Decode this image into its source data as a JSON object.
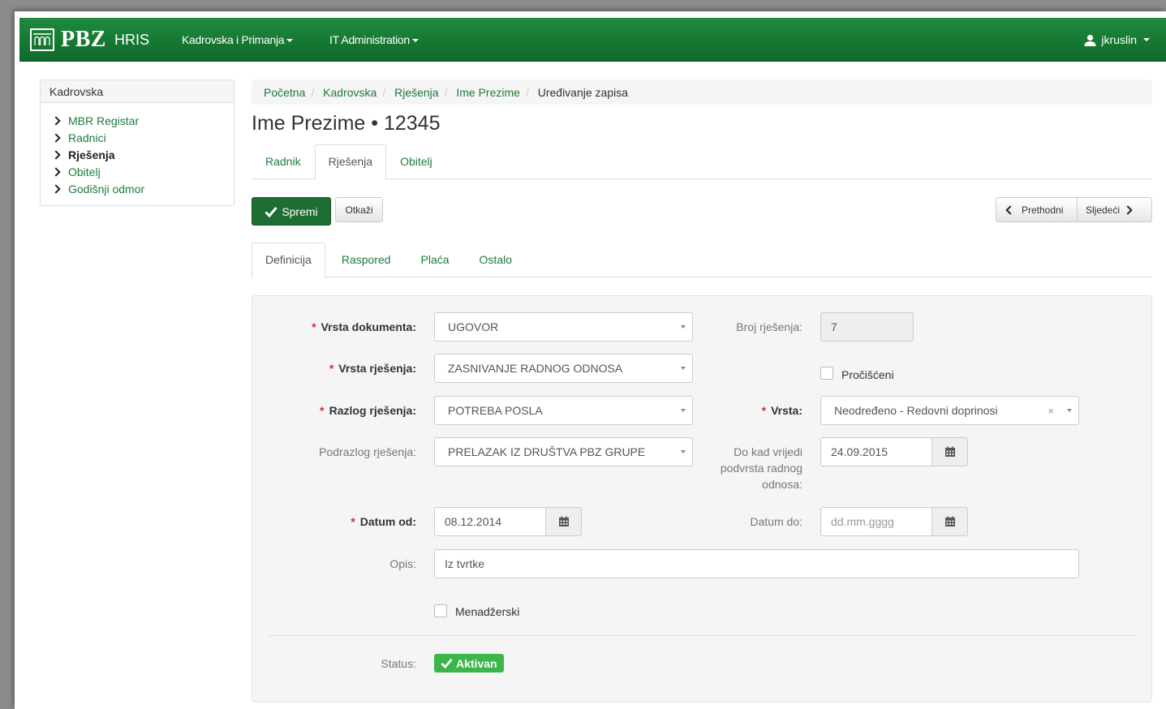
{
  "navbar": {
    "brand_pbz": "PBZ",
    "brand_hris": "HRIS",
    "menu": [
      "Kadrovska i Primanja",
      "IT Administration"
    ],
    "user": "jkruslin"
  },
  "sidebar": {
    "heading": "Kadrovska",
    "items": [
      "MBR Registar",
      "Radnici",
      "Rješenja",
      "Obitelj",
      "Godišnji odmor"
    ],
    "active": "Rješenja"
  },
  "breadcrumb": [
    "Početna",
    "Kadrovska",
    "Rješenja",
    "Ime Prezime",
    "Uređivanje zapisa"
  ],
  "page_title": "Ime Prezime • 12345",
  "main_tabs": [
    "Radnik",
    "Rješenja",
    "Obitelj"
  ],
  "main_tab_active": "Rješenja",
  "toolbar": {
    "save_label": "Spremi",
    "cancel_label": "Otkaži",
    "prev_label": "Prethodni",
    "next_label": "Sljedeći"
  },
  "sub_tabs": [
    "Definicija",
    "Raspored",
    "Plaća",
    "Ostalo"
  ],
  "sub_tab_active": "Definicija",
  "form": {
    "vrsta_dokumenta": {
      "label": "Vrsta dokumenta:",
      "value": "UGOVOR"
    },
    "broj_rjesenja": {
      "label": "Broj rješenja:",
      "value": "7"
    },
    "vrsta_rjesenja": {
      "label": "Vrsta rješenja:",
      "value": "ZASNIVANJE RADNOG ODNOSA"
    },
    "prociscen": {
      "label": "Pročišćeni"
    },
    "razlog_rjesenja": {
      "label": "Razlog rješenja:",
      "value": "POTREBA POSLA"
    },
    "vrsta": {
      "label": "Vrsta:",
      "value": "Neodređeno - Redovni doprinosi"
    },
    "podrazlog_rjesenja": {
      "label": "Podrazlog rješenja:",
      "value": "PRELAZAK IZ DRUŠTVA PBZ GRUPE"
    },
    "do_kad_vrijedi": {
      "label_1": "Do kad vrijedi",
      "label_2": "podvrsta radnog",
      "label_3": "odnosa:",
      "value": "24.09.2015"
    },
    "datum_od": {
      "label": "Datum od:",
      "value": "08.12.2014"
    },
    "datum_do": {
      "label": "Datum do:",
      "placeholder": "dd.mm.gggg"
    },
    "opis": {
      "label": "Opis:",
      "value": "Iz tvrtke"
    },
    "menadzerski": {
      "label": "Menadžerski"
    },
    "status": {
      "label": "Status:",
      "value": "Aktivan"
    }
  },
  "colors": {
    "brand_green": "#1f8a3e",
    "link_green": "#1e7b3a",
    "save_green": "#1e6e34",
    "status_green": "#3cb54a",
    "required_red": "#c9302c"
  }
}
